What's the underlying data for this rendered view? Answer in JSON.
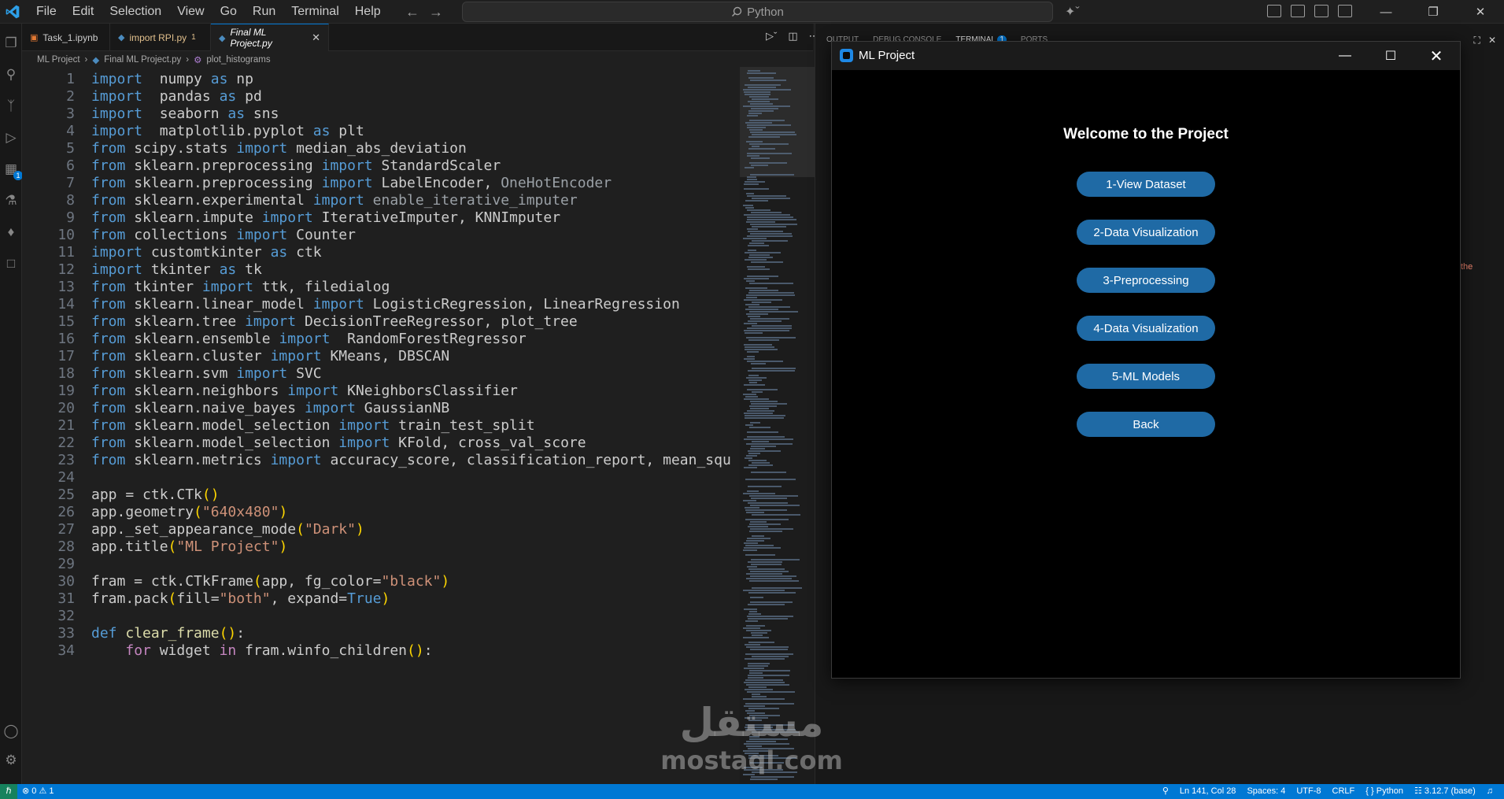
{
  "titlebar": {
    "menus": [
      "File",
      "Edit",
      "Selection",
      "View",
      "Go",
      "Run",
      "Terminal",
      "Help"
    ],
    "search": "Python"
  },
  "tabs": [
    {
      "label": "Task_1.ipynb",
      "color": "#cccccc"
    },
    {
      "label": "import RPI.py",
      "badge": "1",
      "color": "#e2c08d"
    },
    {
      "label": "Final ML Project.py",
      "color": "#ffffff"
    }
  ],
  "breadcrumb": [
    "ML Project",
    "Final ML Project.py",
    "plot_histograms"
  ],
  "panel": {
    "tabs": [
      "OUTPUT",
      "DEBUG CONSOLE",
      "TERMINAL",
      "PORTS"
    ],
    "terminal_badge": "1",
    "glimpse_text": "the"
  },
  "code": [
    {
      "n": "1",
      "t": [
        [
          "kw",
          "import"
        ],
        [
          "",
          "  numpy "
        ],
        [
          "kw",
          "as"
        ],
        [
          "",
          " np"
        ]
      ]
    },
    {
      "n": "2",
      "t": [
        [
          "kw",
          "import"
        ],
        [
          "",
          "  pandas "
        ],
        [
          "kw",
          "as"
        ],
        [
          "",
          " pd"
        ]
      ]
    },
    {
      "n": "3",
      "t": [
        [
          "kw",
          "import"
        ],
        [
          "",
          "  seaborn "
        ],
        [
          "kw",
          "as"
        ],
        [
          "",
          " sns"
        ]
      ]
    },
    {
      "n": "4",
      "t": [
        [
          "kw",
          "import"
        ],
        [
          "",
          "  matplotlib.pyplot "
        ],
        [
          "kw",
          "as"
        ],
        [
          "",
          " plt"
        ]
      ]
    },
    {
      "n": "5",
      "t": [
        [
          "kw",
          "from"
        ],
        [
          "",
          " scipy.stats "
        ],
        [
          "kw",
          "import"
        ],
        [
          "",
          " median_abs_deviation"
        ]
      ]
    },
    {
      "n": "6",
      "t": [
        [
          "kw",
          "from"
        ],
        [
          "",
          " sklearn.preprocessing "
        ],
        [
          "kw",
          "import"
        ],
        [
          "",
          " StandardScaler"
        ]
      ]
    },
    {
      "n": "7",
      "t": [
        [
          "kw",
          "from"
        ],
        [
          "",
          " sklearn.preprocessing "
        ],
        [
          "kw",
          "import"
        ],
        [
          "",
          " LabelEncoder, "
        ],
        [
          "dim",
          "OneHotEncoder"
        ]
      ]
    },
    {
      "n": "8",
      "t": [
        [
          "kw",
          "from"
        ],
        [
          "",
          " sklearn.experimental "
        ],
        [
          "kw",
          "import"
        ],
        [
          "dim",
          " enable_iterative_imputer"
        ]
      ]
    },
    {
      "n": "9",
      "t": [
        [
          "kw",
          "from"
        ],
        [
          "",
          " sklearn.impute "
        ],
        [
          "kw",
          "import"
        ],
        [
          "",
          " IterativeImputer, KNNImputer"
        ]
      ]
    },
    {
      "n": "10",
      "t": [
        [
          "kw",
          "from"
        ],
        [
          "",
          " collections "
        ],
        [
          "kw",
          "import"
        ],
        [
          "",
          " Counter"
        ]
      ]
    },
    {
      "n": "11",
      "t": [
        [
          "kw",
          "import"
        ],
        [
          "",
          " customtkinter "
        ],
        [
          "kw",
          "as"
        ],
        [
          "",
          " ctk"
        ]
      ]
    },
    {
      "n": "12",
      "t": [
        [
          "kw",
          "import"
        ],
        [
          "",
          " tkinter "
        ],
        [
          "kw",
          "as"
        ],
        [
          "",
          " tk"
        ]
      ]
    },
    {
      "n": "13",
      "t": [
        [
          "kw",
          "from"
        ],
        [
          "",
          " tkinter "
        ],
        [
          "kw",
          "import"
        ],
        [
          "",
          " ttk, filedialog"
        ]
      ]
    },
    {
      "n": "14",
      "t": [
        [
          "kw",
          "from"
        ],
        [
          "",
          " sklearn.linear_model "
        ],
        [
          "kw",
          "import"
        ],
        [
          "",
          " LogisticRegression, LinearRegression"
        ]
      ]
    },
    {
      "n": "15",
      "t": [
        [
          "kw",
          "from"
        ],
        [
          "",
          " sklearn.tree "
        ],
        [
          "kw",
          "import"
        ],
        [
          "",
          " DecisionTreeRegressor, plot_tree"
        ]
      ]
    },
    {
      "n": "16",
      "t": [
        [
          "kw",
          "from"
        ],
        [
          "",
          " sklearn.ensemble "
        ],
        [
          "kw",
          "import"
        ],
        [
          "",
          "  RandomForestRegressor"
        ]
      ]
    },
    {
      "n": "17",
      "t": [
        [
          "kw",
          "from"
        ],
        [
          "",
          " sklearn.cluster "
        ],
        [
          "kw",
          "import"
        ],
        [
          "",
          " KMeans, DBSCAN"
        ]
      ]
    },
    {
      "n": "18",
      "t": [
        [
          "kw",
          "from"
        ],
        [
          "",
          " sklearn.svm "
        ],
        [
          "kw",
          "import"
        ],
        [
          "",
          " SVC"
        ]
      ]
    },
    {
      "n": "19",
      "t": [
        [
          "kw",
          "from"
        ],
        [
          "",
          " sklearn.neighbors "
        ],
        [
          "kw",
          "import"
        ],
        [
          "",
          " KNeighborsClassifier"
        ]
      ]
    },
    {
      "n": "20",
      "t": [
        [
          "kw",
          "from"
        ],
        [
          "",
          " sklearn.naive_bayes "
        ],
        [
          "kw",
          "import"
        ],
        [
          "",
          " GaussianNB"
        ]
      ]
    },
    {
      "n": "21",
      "t": [
        [
          "kw",
          "from"
        ],
        [
          "",
          " sklearn.model_selection "
        ],
        [
          "kw",
          "import"
        ],
        [
          "",
          " train_test_split"
        ]
      ]
    },
    {
      "n": "22",
      "t": [
        [
          "kw",
          "from"
        ],
        [
          "",
          " sklearn.model_selection "
        ],
        [
          "kw",
          "import"
        ],
        [
          "",
          " KFold, cross_val_score"
        ]
      ]
    },
    {
      "n": "23",
      "t": [
        [
          "kw",
          "from"
        ],
        [
          "",
          " sklearn.metrics "
        ],
        [
          "kw",
          "import"
        ],
        [
          "",
          " accuracy_score, classification_report, mean_squ"
        ]
      ]
    },
    {
      "n": "24",
      "t": []
    },
    {
      "n": "25",
      "t": [
        [
          "",
          "app = ctk.CTk"
        ],
        [
          "par",
          "()"
        ]
      ]
    },
    {
      "n": "26",
      "t": [
        [
          "",
          "app.geometry"
        ],
        [
          "par",
          "("
        ],
        [
          "str",
          "\"640x480\""
        ],
        [
          "par",
          ")"
        ]
      ]
    },
    {
      "n": "27",
      "t": [
        [
          "",
          "app._set_appearance_mode"
        ],
        [
          "par",
          "("
        ],
        [
          "str",
          "\"Dark\""
        ],
        [
          "par",
          ")"
        ]
      ]
    },
    {
      "n": "28",
      "t": [
        [
          "",
          "app.title"
        ],
        [
          "par",
          "("
        ],
        [
          "str",
          "\"ML Project\""
        ],
        [
          "par",
          ")"
        ]
      ]
    },
    {
      "n": "29",
      "t": []
    },
    {
      "n": "30",
      "t": [
        [
          "",
          "fram = ctk.CTkFrame"
        ],
        [
          "par",
          "("
        ],
        [
          "",
          "app, fg_color="
        ],
        [
          "str",
          "\"black\""
        ],
        [
          "par",
          ")"
        ]
      ]
    },
    {
      "n": "31",
      "t": [
        [
          "",
          "fram.pack"
        ],
        [
          "par",
          "("
        ],
        [
          "",
          "fill="
        ],
        [
          "str",
          "\"both\""
        ],
        [
          "",
          ", expand="
        ],
        [
          "kw",
          "True"
        ],
        [
          "par",
          ")"
        ]
      ]
    },
    {
      "n": "32",
      "t": []
    },
    {
      "n": "33",
      "t": [
        [
          "kw",
          "def"
        ],
        [
          "",
          " "
        ],
        [
          "fn",
          "clear_frame"
        ],
        [
          "par",
          "()"
        ],
        [
          "",
          ":"
        ]
      ]
    },
    {
      "n": "34",
      "t": [
        [
          "",
          "    "
        ],
        [
          "ctl",
          "for"
        ],
        [
          "",
          " widget "
        ],
        [
          "ctl",
          "in"
        ],
        [
          "",
          " fram.winfo_children"
        ],
        [
          "par",
          "()"
        ],
        [
          "",
          ":"
        ]
      ]
    }
  ],
  "ml_window": {
    "title": "ML Project",
    "heading": "Welcome to the Project",
    "buttons": [
      "1-View Dataset",
      "2-Data Visualization",
      "3-Preprocessing",
      "4-Data Visualization",
      "5-ML Models",
      "Back"
    ],
    "button_color": "#1f6aa5"
  },
  "watermark": {
    "arabic": "مستقل",
    "latin": "mostaql.com"
  },
  "statusbar": {
    "errors": "0",
    "warnings": "1",
    "position": "Ln 141, Col 28",
    "spaces": "Spaces: 4",
    "encoding": "UTF-8",
    "eol": "CRLF",
    "language": "Python",
    "interpreter": "3.12.7 (base)"
  },
  "colors": {
    "accent": "#0078d4",
    "status_bar": "#0078d4",
    "editor_bg": "#1f1f1f",
    "keyword": "#569cd6",
    "string": "#ce9178"
  }
}
